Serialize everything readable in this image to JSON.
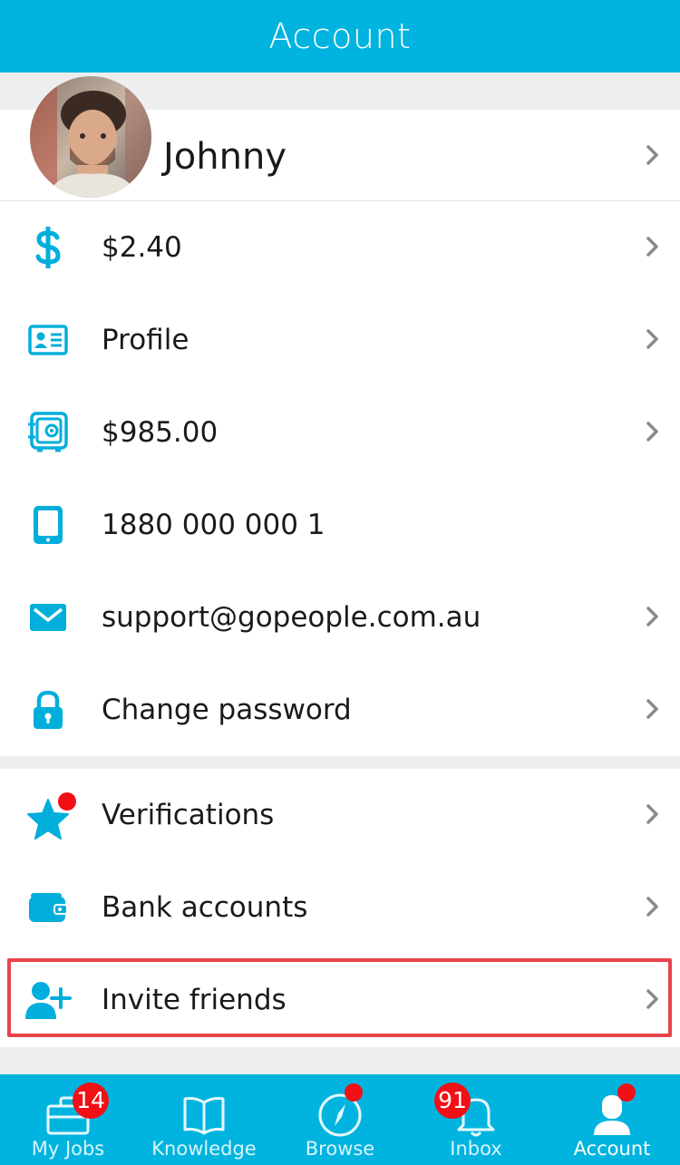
{
  "header": {
    "title": "Account"
  },
  "profile": {
    "name": "Johnny"
  },
  "menu": [
    {
      "icon": "dollar-icon",
      "label": "$2.40",
      "has_chevron": true
    },
    {
      "icon": "id-card-icon",
      "label": "Profile",
      "has_chevron": true
    },
    {
      "icon": "safe-icon",
      "label": "$985.00",
      "has_chevron": true
    },
    {
      "icon": "phone-icon",
      "label": "1880 000 000 1",
      "has_chevron": false
    },
    {
      "icon": "mail-icon",
      "label": "support@gopeople.com.au",
      "has_chevron": true
    },
    {
      "icon": "lock-icon",
      "label": "Change password",
      "has_chevron": true
    },
    {
      "icon": "star-icon",
      "label": "Verifications",
      "has_chevron": true,
      "notification_dot": true
    },
    {
      "icon": "wallet-icon",
      "label": "Bank accounts",
      "has_chevron": true
    },
    {
      "icon": "add-user-icon",
      "label": "Invite friends",
      "has_chevron": true,
      "highlighted": true
    }
  ],
  "tabs": [
    {
      "icon": "briefcase-icon",
      "label": "My Jobs",
      "badge": "14"
    },
    {
      "icon": "book-icon",
      "label": "Knowledge"
    },
    {
      "icon": "compass-icon",
      "label": "Browse",
      "dot": true
    },
    {
      "icon": "bell-icon",
      "label": "Inbox",
      "badge": "91"
    },
    {
      "icon": "user-icon",
      "label": "Account",
      "dot": true,
      "active": true
    }
  ],
  "colors": {
    "accent": "#00B4DF",
    "badge": "#F01016",
    "highlight": "#E9434A",
    "separator": "#EEEEEF"
  }
}
